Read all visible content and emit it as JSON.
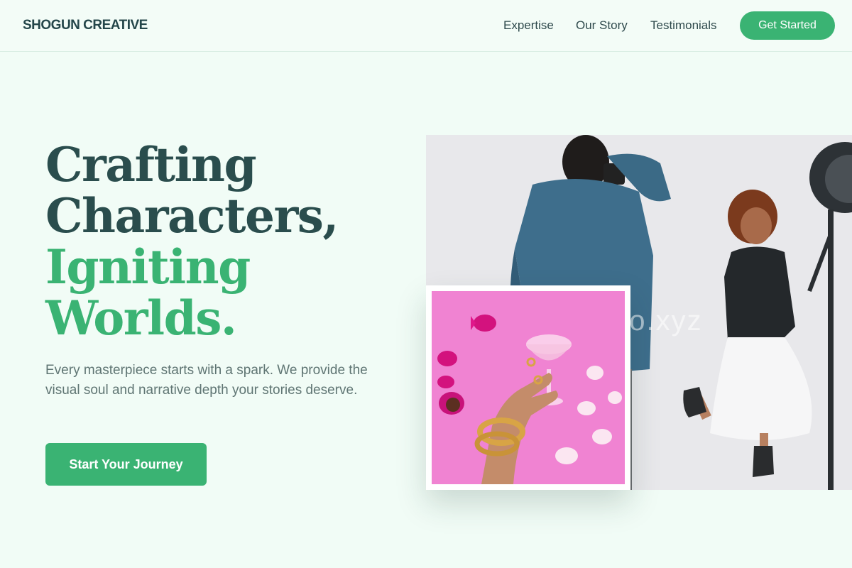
{
  "header": {
    "brand": "SHOGUN CREATIVE",
    "nav": [
      {
        "label": "Expertise"
      },
      {
        "label": "Our Story"
      },
      {
        "label": "Testimonials"
      }
    ],
    "cta_label": "Get Started"
  },
  "hero": {
    "headline_line1": "Crafting",
    "headline_line2": "Characters,",
    "headline_line3": "Igniting",
    "headline_line4": "Worlds.",
    "subtext": "Every masterpiece starts with a spark. We provide the visual soul and narrative depth your stories deserve.",
    "cta_label": "Start Your Journey",
    "photo_main_watermark": "eko.xyz"
  },
  "colors": {
    "accent": "#3ab373",
    "heading_dark": "#2a4d4d",
    "background": "#f1fcf6"
  },
  "icons": {
    "photo_main": "photographer-shoot-image",
    "photo_inset": "jewelry-hand-pink-image"
  }
}
